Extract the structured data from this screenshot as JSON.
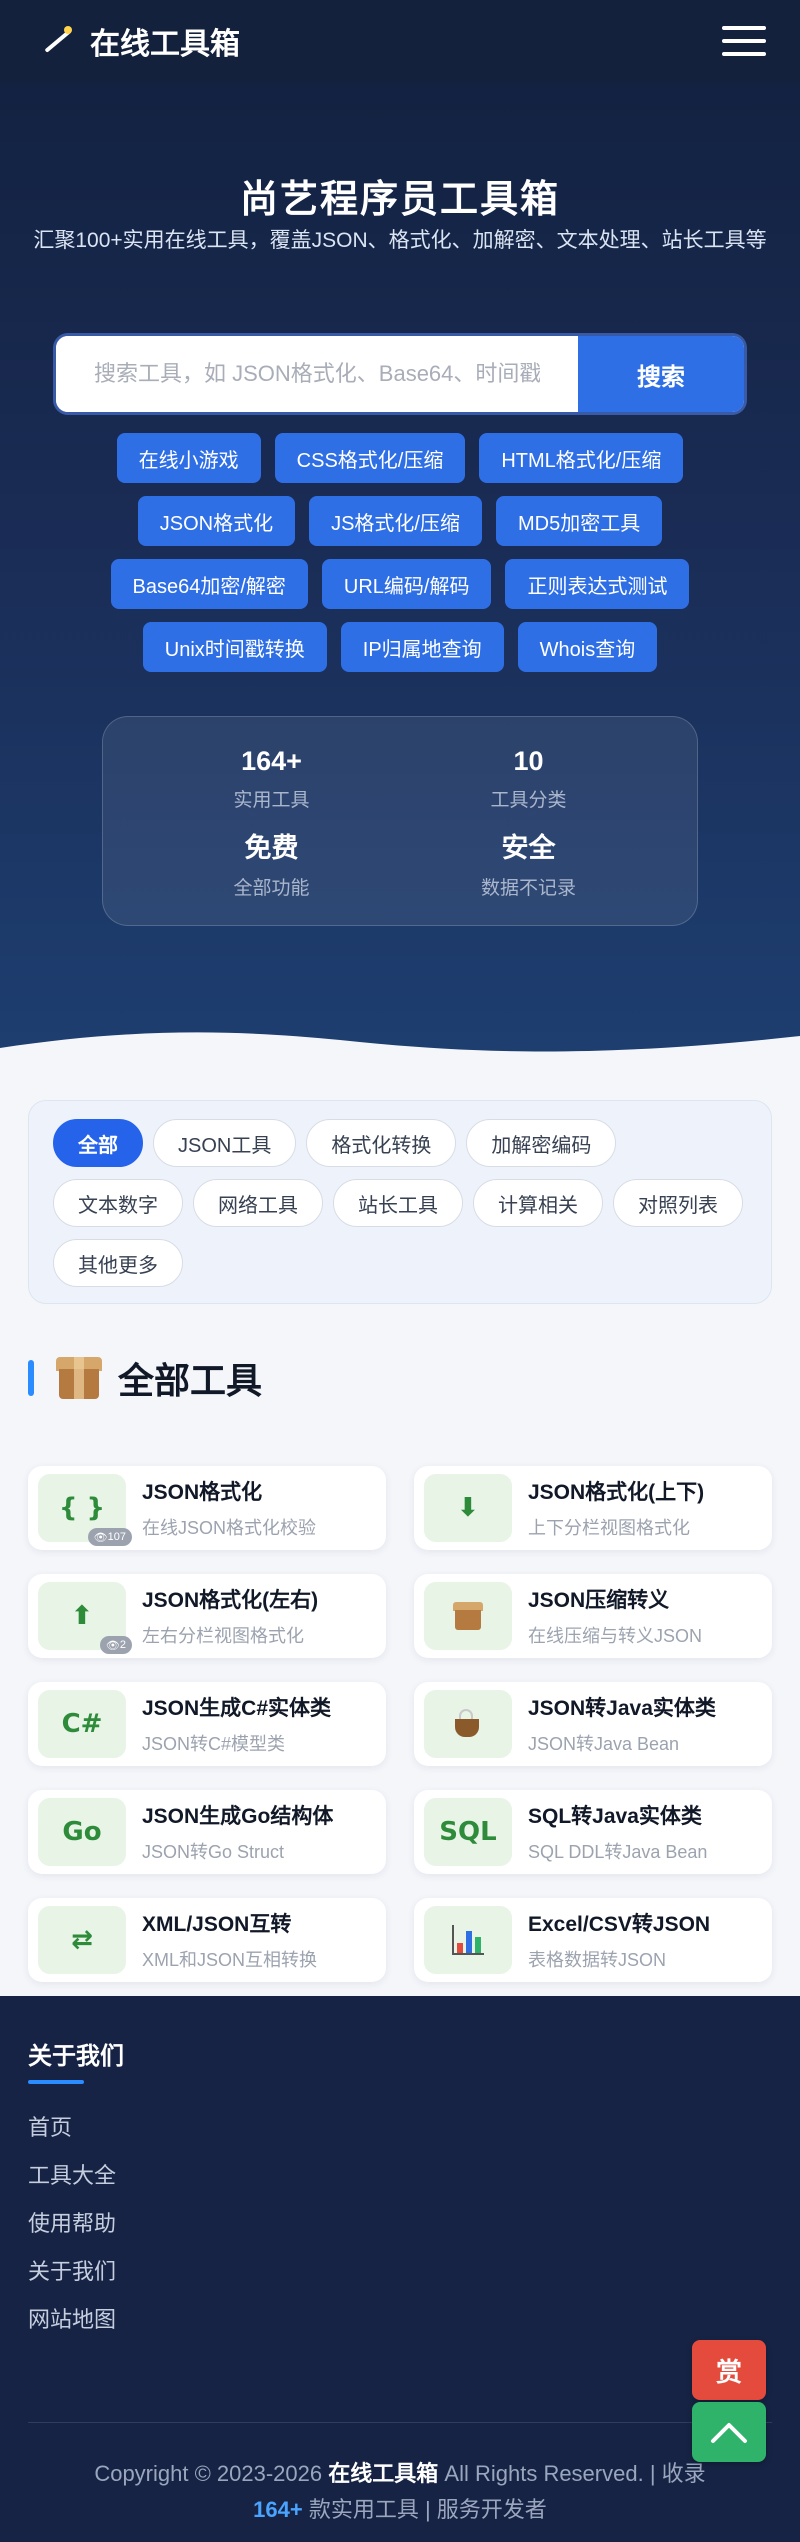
{
  "navbar": {
    "brand": "在线工具箱",
    "brand_icon": "magic-wand-icon",
    "menu_icon": "hamburger-menu-icon"
  },
  "hero": {
    "title": "尚艺程序员工具箱",
    "subtitle": "汇聚100+实用在线工具，覆盖JSON、格式化、加解密、文本处理、站长工具等",
    "search_placeholder": "搜索工具，如 JSON格式化、Base64、时间戳...",
    "search_button": "搜索",
    "quick_links": [
      "在线小游戏",
      "CSS格式化/压缩",
      "HTML格式化/压缩",
      "JSON格式化",
      "JS格式化/压缩",
      "MD5加密工具",
      "Base64加密/解密",
      "URL编码/解码",
      "正则表达式测试",
      "Unix时间戳转换",
      "IP归属地查询",
      "Whois查询"
    ],
    "stats": [
      {
        "value": "164+",
        "label": "实用工具"
      },
      {
        "value": "10",
        "label": "工具分类"
      },
      {
        "value": "免费",
        "label": "全部功能"
      },
      {
        "value": "安全",
        "label": "数据不记录"
      }
    ]
  },
  "filters": {
    "active": "全部",
    "items": [
      "全部",
      "JSON工具",
      "格式化转换",
      "加解密编码",
      "文本数字",
      "网络工具",
      "站长工具",
      "计算相关",
      "对照列表",
      "其他更多"
    ]
  },
  "section": {
    "title": "全部工具",
    "icon": "package-box-icon"
  },
  "tools": [
    {
      "name": "JSON格式化",
      "desc": "在线JSON格式化校验",
      "icon": "{ }",
      "icon_name": "braces-icon",
      "views": "107"
    },
    {
      "name": "JSON格式化(上下)",
      "desc": "上下分栏视图格式化",
      "icon": "⬇",
      "icon_name": "down-arrow-icon",
      "views": ""
    },
    {
      "name": "JSON格式化(左右)",
      "desc": "左右分栏视图格式化",
      "icon": "⬆",
      "icon_name": "up-arrow-icon",
      "views": "2"
    },
    {
      "name": "JSON压缩转义",
      "desc": "在线压缩与转义JSON",
      "icon": "",
      "icon_name": "package-box-icon",
      "views": ""
    },
    {
      "name": "JSON生成C#实体类",
      "desc": "JSON转C#模型类",
      "icon": "C#",
      "icon_name": "csharp-icon",
      "views": ""
    },
    {
      "name": "JSON转Java实体类",
      "desc": "JSON转Java Bean",
      "icon": "",
      "icon_name": "coffee-cup-icon",
      "views": ""
    },
    {
      "name": "JSON生成Go结构体",
      "desc": "JSON转Go Struct",
      "icon": "Go",
      "icon_name": "go-icon",
      "views": ""
    },
    {
      "name": "SQL转Java实体类",
      "desc": "SQL DDL转Java Bean",
      "icon": "SQL",
      "icon_name": "sql-icon",
      "views": ""
    },
    {
      "name": "XML/JSON互转",
      "desc": "XML和JSON互相转换",
      "icon": "⇄",
      "icon_name": "swap-arrows-icon",
      "views": ""
    },
    {
      "name": "Excel/CSV转JSON",
      "desc": "表格数据转JSON",
      "icon": "",
      "icon_name": "bar-chart-icon",
      "views": ""
    }
  ],
  "footer": {
    "about_title": "关于我们",
    "links": [
      "首页",
      "工具大全",
      "使用帮助",
      "关于我们",
      "网站地图"
    ],
    "copyright_prefix": "Copyright © 2023-2026",
    "copyright_brand": "在线工具箱",
    "copyright_rights": "All Rights Reserved. | 收录",
    "tool_count": "164+",
    "copyright_suffix": "款实用工具 | 服务开发者"
  },
  "floating": {
    "reward_label": "赏",
    "reward_color": "#e44b3d",
    "back_top_icon": "chevron-up-icon",
    "back_top_color": "#2fb36a"
  },
  "colors": {
    "primary": "#2f6fe6",
    "navbar_bg": "#14213d",
    "footer_bg": "#162344",
    "tool_icon_bg": "#e7f4e6",
    "tool_icon_fg": "#2e8b3a"
  }
}
